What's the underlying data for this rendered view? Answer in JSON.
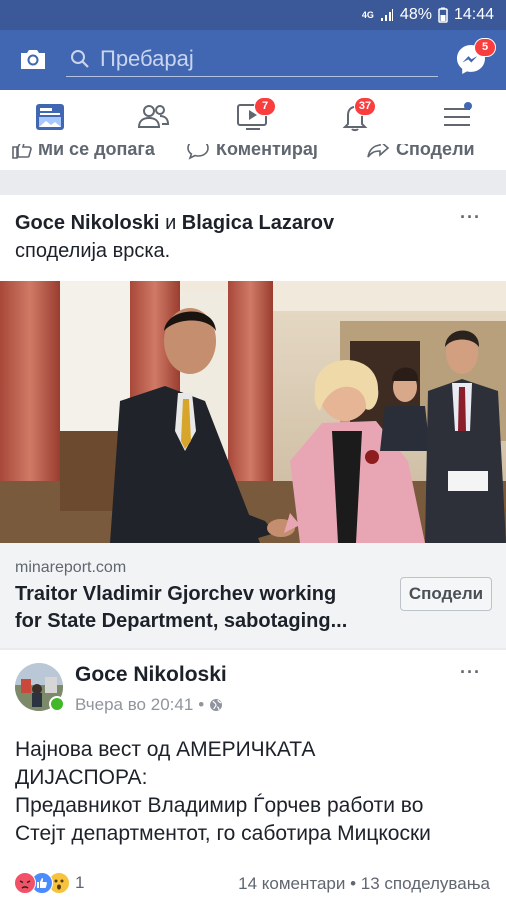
{
  "status_bar": {
    "network": "4G",
    "battery": "48%",
    "time": "14:44"
  },
  "search": {
    "placeholder": "Пребарај"
  },
  "badges": {
    "messenger": "5",
    "video": "7",
    "notifications": "37"
  },
  "action_bar": {
    "like": "Ми се допаѓа",
    "comment": "Коментирај",
    "share": "Сподели"
  },
  "shared_post": {
    "author1": "Goce Nikoloski",
    "conj": "и",
    "author2": "Blagica Lazarov",
    "verb": "споделија врска.",
    "more": "···",
    "link": {
      "domain": "minareport.com",
      "title_line1": "Traitor Vladimir Gjorchev working",
      "title_line2": "for State Department, sabotaging...",
      "share_button": "Сподели"
    }
  },
  "post": {
    "author": "Goce Nikoloski",
    "time": "Вчера во 20:41",
    "sep": "•",
    "more": "···",
    "lines": [
      "Најнова вест од АМЕРИЧКАТА",
      "ДИЈАСПОРА:",
      "Предавникот Владимир Ѓорчев работи во",
      "Стејт департментот, го саботира Мицкоски"
    ],
    "reactions_count": "1",
    "stats": "14 коментари • 13 споделувања"
  },
  "colors": {
    "brand": "#4267b2",
    "status_bar": "#3b5998",
    "badge": "#fa3e3e"
  }
}
